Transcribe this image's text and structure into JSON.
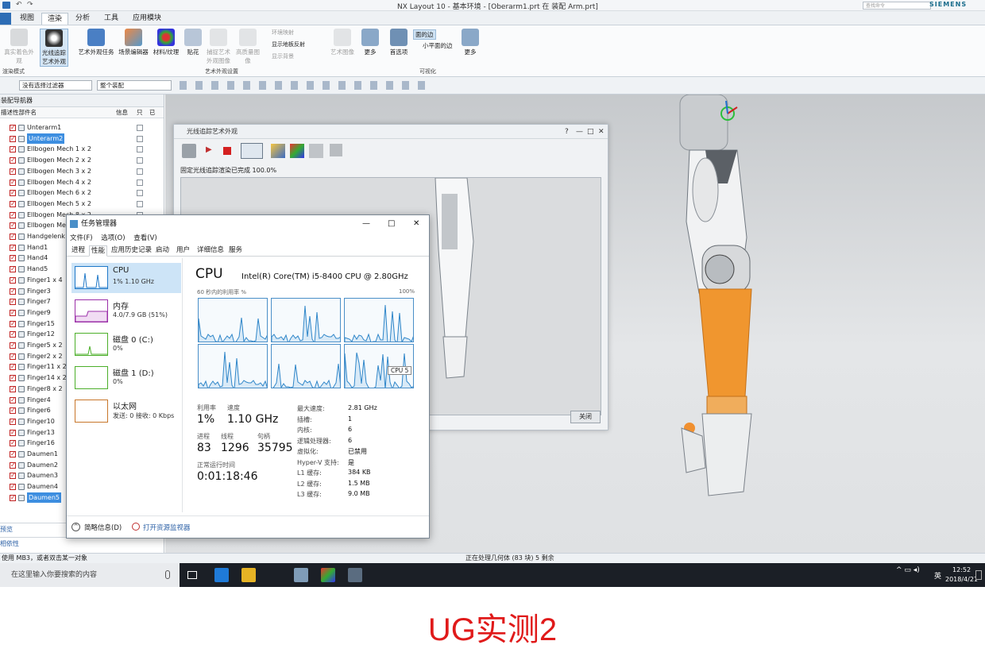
{
  "window": {
    "title": "NX Layout 10 - 基本环境 - [Oberarm1.prt 在 装配 Arm.prt]",
    "brand": "SIEMENS",
    "search_placeholder": "查找命令"
  },
  "ribbon": {
    "tabs": [
      "视图",
      "渲染",
      "分析",
      "工具",
      "应用模块"
    ],
    "active_tab": "渲染",
    "buttons": [
      {
        "label": "真实着色外观",
        "enabled": false
      },
      {
        "label": "光线追踪艺术外观",
        "enabled": true
      },
      {
        "label": "艺术外观任务",
        "enabled": true
      },
      {
        "label": "场景编辑器",
        "enabled": true
      },
      {
        "label": "材料/纹理",
        "enabled": true
      },
      {
        "label": "贴花",
        "enabled": true
      },
      {
        "label": "捕捉艺术外观图像",
        "enabled": false
      },
      {
        "label": "高质量图像",
        "enabled": false
      },
      {
        "label": "显示地板反射",
        "enabled": true
      },
      {
        "label": "艺术图像",
        "enabled": false
      },
      {
        "label": "更多",
        "enabled": true
      },
      {
        "label": "首选项",
        "enabled": true
      },
      {
        "label": "面的边",
        "enabled": true
      },
      {
        "label": "小平面的边",
        "enabled": true
      },
      {
        "label": "更多",
        "enabled": true
      }
    ],
    "small_items": [
      "环境映射",
      "显示地板反射",
      "显示背景"
    ],
    "groups": [
      "渲染模式",
      "艺术外观设置",
      "可视化"
    ]
  },
  "toolbar": {
    "filter_combo": "没有选择过滤器",
    "assembly_combo": "整个装配"
  },
  "navigator": {
    "title": "装配导航器",
    "col_name": "描述性部件名",
    "col_info": "信息",
    "col_only": "只",
    "col_r": "已",
    "rows": [
      {
        "name": "Unterarm1",
        "selected": false
      },
      {
        "name": "Unterarm2",
        "selected": true
      },
      {
        "name": "Ellbogen Mech 1 x 2",
        "selected": false
      },
      {
        "name": "Ellbogen Mech 2 x 2",
        "selected": false
      },
      {
        "name": "Ellbogen Mech 3 x 2",
        "selected": false
      },
      {
        "name": "Ellbogen Mech 4 x 2",
        "selected": false
      },
      {
        "name": "Ellbogen Mech 6 x 2",
        "selected": false
      },
      {
        "name": "Ellbogen Mech 5 x 2",
        "selected": false
      },
      {
        "name": "Ellbogen Mech 8 x 2",
        "selected": false
      },
      {
        "name": "Ellbogen Mech 7 x 2",
        "selected": false
      },
      {
        "name": "Handgelenk",
        "selected": false
      },
      {
        "name": "Hand1",
        "selected": false
      },
      {
        "name": "Hand4",
        "selected": false
      },
      {
        "name": "Hand5",
        "selected": false
      },
      {
        "name": "Finger1 x 4",
        "selected": false
      },
      {
        "name": "Finger3",
        "selected": false
      },
      {
        "name": "Finger7",
        "selected": false
      },
      {
        "name": "Finger9",
        "selected": false
      },
      {
        "name": "Finger15",
        "selected": false
      },
      {
        "name": "Finger12",
        "selected": false
      },
      {
        "name": "Finger5 x 2",
        "selected": false
      },
      {
        "name": "Finger2 x 2",
        "selected": false
      },
      {
        "name": "Finger11 x 2",
        "selected": false
      },
      {
        "name": "Finger14 x 2",
        "selected": false
      },
      {
        "name": "Finger8 x 2",
        "selected": false
      },
      {
        "name": "Finger4",
        "selected": false
      },
      {
        "name": "Finger6",
        "selected": false
      },
      {
        "name": "Finger10",
        "selected": false
      },
      {
        "name": "Finger13",
        "selected": false
      },
      {
        "name": "Finger16",
        "selected": false
      },
      {
        "name": "Daumen1",
        "selected": false
      },
      {
        "name": "Daumen2",
        "selected": false
      },
      {
        "name": "Daumen3",
        "selected": false
      },
      {
        "name": "Daumen4",
        "selected": false
      },
      {
        "name": "Daumen5",
        "selected": true
      }
    ],
    "footer1": "预览",
    "footer2": "相依性"
  },
  "raytrace_window": {
    "title": "光线追踪艺术外观",
    "status": "固定光线追踪渲染已完成 100.0%",
    "close_label": "关闭"
  },
  "task_manager": {
    "title": "任务管理器",
    "menu": [
      "文件(F)",
      "选项(O)",
      "查看(V)"
    ],
    "tabs": [
      "进程",
      "性能",
      "应用历史记录",
      "启动",
      "用户",
      "详细信息",
      "服务"
    ],
    "active_tab": "性能",
    "resources": [
      {
        "name": "CPU",
        "value": "1% 1.10 GHz",
        "color": "#1f78c8"
      },
      {
        "name": "内存",
        "value": "4.0/7.9 GB (51%)",
        "color": "#9b2fa8"
      },
      {
        "name": "磁盘 0 (C:)",
        "value": "0%",
        "color": "#4caf2a"
      },
      {
        "name": "磁盘 1 (D:)",
        "value": "0%",
        "color": "#4caf2a"
      },
      {
        "name": "以太网",
        "value": "发送: 0 接收: 0 Kbps",
        "color": "#c8762a"
      }
    ],
    "cpu_heading": "CPU",
    "cpu_name": "Intel(R) Core(TM) i5-8400 CPU @ 2.80GHz",
    "graph_caption": "60 秒内的利用率 %",
    "graph_max": "100%",
    "graph_tooltip": "CPU 5",
    "stats": {
      "util_label": "利用率",
      "util_value": "1%",
      "speed_label": "速度",
      "speed_value": "1.10 GHz",
      "proc_label": "进程",
      "proc_value": "83",
      "thread_label": "线程",
      "thread_value": "1296",
      "handle_label": "句柄",
      "handle_value": "35795",
      "uptime_label": "正常运行时间",
      "uptime_value": "0:01:18:46"
    },
    "details": [
      {
        "k": "最大速度:",
        "v": "2.81 GHz"
      },
      {
        "k": "插槽:",
        "v": "1"
      },
      {
        "k": "内核:",
        "v": "6"
      },
      {
        "k": "逻辑处理器:",
        "v": "6"
      },
      {
        "k": "虚拟化:",
        "v": "已禁用"
      },
      {
        "k": "Hyper-V 支持:",
        "v": "是"
      },
      {
        "k": "L1 缓存:",
        "v": "384 KB"
      },
      {
        "k": "L2 缓存:",
        "v": "1.5 MB"
      },
      {
        "k": "L3 缓存:",
        "v": "9.0 MB"
      }
    ],
    "footer_brief": "简略信息(D)",
    "footer_monitor": "打开资源监视器"
  },
  "statusbar": {
    "left": "使用 MB3，或者双击某一对象",
    "center": "正在处理几何体 (83 块)  5 剩余"
  },
  "taskbar": {
    "search_placeholder": "在这里输入你要搜索的内容",
    "ime": "英",
    "time": "12:52",
    "date": "2018/4/21"
  },
  "caption": "UG实测2"
}
